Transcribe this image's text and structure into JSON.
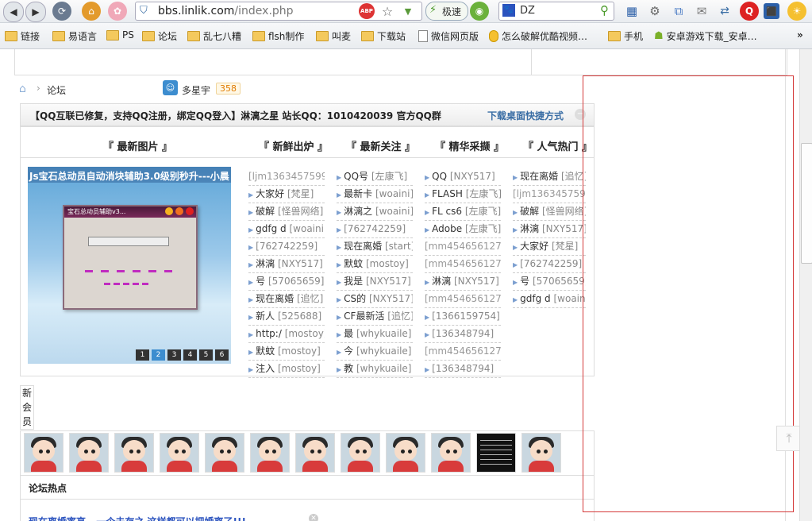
{
  "browser": {
    "url_domain": "bbs.linlik.com",
    "url_path": "/index.php",
    "speed_label": "极速",
    "search_value": "DZ",
    "bookmarks": [
      {
        "label": "链接",
        "kind": "folder"
      },
      {
        "label": "易语言",
        "kind": "folder"
      },
      {
        "label": "PS",
        "kind": "folder"
      },
      {
        "label": "论坛",
        "kind": "folder"
      },
      {
        "label": "乱七八糟",
        "kind": "folder"
      },
      {
        "label": "flsh制作",
        "kind": "folder"
      },
      {
        "label": "叫麦",
        "kind": "folder"
      },
      {
        "label": "下载站",
        "kind": "folder"
      },
      {
        "label": "微信网页版",
        "kind": "page"
      },
      {
        "label": "怎么破解优酷视频…",
        "kind": "page"
      },
      {
        "label": "手机",
        "kind": "folder"
      },
      {
        "label": "安卓游戏下载_安卓…",
        "kind": "page"
      }
    ],
    "more_label": "»",
    "abp_label": "ABP"
  },
  "forum": {
    "breadcrumb": "论坛",
    "user_name": "多星宇",
    "user_points": "358",
    "announcement": "【QQ互联已修复，支持QQ注册，绑定QQ登入】淋漓之星 站长QQ：1010420039 官方QQ群",
    "announcement_tail": "下载桌面快捷方式",
    "columns": [
      "『 最新图片 』",
      "『 新鲜出炉 』",
      "『 最新关注 』",
      "『 精华采撷 』",
      "『 人气热门 』"
    ],
    "slide_caption": "Js宝石总动员自动消块辅助3.0级别秒升---小晨",
    "slide_dialog_title": "宝石总动员辅助v3...",
    "slide_numbers": [
      "1",
      "2",
      "3",
      "4",
      "5",
      "6"
    ],
    "list_fresh": [
      {
        "t": "[ljm1363457599",
        "u": ""
      },
      {
        "t": "大家好",
        "u": "[梵星]"
      },
      {
        "t": "破解",
        "u": "[怪兽网络]"
      },
      {
        "t": "gdfg d",
        "u": "[woaini]"
      },
      {
        "t": "",
        "u": "[762742259]"
      },
      {
        "t": "淋漓",
        "u": "[NXY517]"
      },
      {
        "t": "号",
        "u": "[57065659]"
      },
      {
        "t": "现在离婚",
        "u": "[追忆]"
      },
      {
        "t": "新人",
        "u": "[525688]"
      },
      {
        "t": "http:/",
        "u": "[mostoy]"
      },
      {
        "t": "默蚊",
        "u": "[mostoy]"
      },
      {
        "t": "注入",
        "u": "[mostoy]"
      }
    ],
    "list_focus": [
      {
        "t": "QQ号",
        "u": "[左康飞]"
      },
      {
        "t": "最新卡",
        "u": "[woaini]"
      },
      {
        "t": "淋漓之",
        "u": "[woaini]"
      },
      {
        "t": "",
        "u": "[762742259]"
      },
      {
        "t": "现在离婚",
        "u": "[start]"
      },
      {
        "t": "默蚊",
        "u": "[mostoy]"
      },
      {
        "t": "我是",
        "u": "[NXY517]"
      },
      {
        "t": "CS的",
        "u": "[NXY517]"
      },
      {
        "t": "CF最新活",
        "u": "[追忆]"
      },
      {
        "t": "最",
        "u": "[whykuaile]"
      },
      {
        "t": "今",
        "u": "[whykuaile]"
      },
      {
        "t": "教",
        "u": "[whykuaile]"
      }
    ],
    "list_elite": [
      {
        "t": "QQ",
        "u": "[NXY517]"
      },
      {
        "t": "FLASH",
        "u": "[左康飞]"
      },
      {
        "t": "FL cs6",
        "u": "[左康飞]"
      },
      {
        "t": "Adobe",
        "u": "[左康飞]"
      },
      {
        "t": "[mm454656127",
        "u": ""
      },
      {
        "t": "[mm454656127",
        "u": ""
      },
      {
        "t": "淋漓",
        "u": "[NXY517]"
      },
      {
        "t": "[mm454656127",
        "u": ""
      },
      {
        "t": "",
        "u": "[1366159754]"
      },
      {
        "t": "",
        "u": "[136348794]"
      },
      {
        "t": "[mm454656127",
        "u": ""
      },
      {
        "t": "",
        "u": "[136348794]"
      }
    ],
    "list_hot": [
      {
        "t": "现在离婚",
        "u": "[追忆]"
      },
      {
        "t": "[ljm1363457599",
        "u": ""
      },
      {
        "t": "破解",
        "u": "[怪兽网络]"
      },
      {
        "t": "淋漓",
        "u": "[NXY517]"
      },
      {
        "t": "大家好",
        "u": "[梵星]"
      },
      {
        "t": "",
        "u": "[762742259]"
      },
      {
        "t": "号",
        "u": "[57065659]"
      },
      {
        "t": "gdfg d",
        "u": "[woaini]"
      }
    ],
    "new_members_label": "新会员",
    "hot_threads_label": "论坛热点",
    "hot_thread_1": "现在离婚率高 - 一个去存之 这样都可以把婚离了!!!",
    "back_top_icon": "back-to-top-icon"
  }
}
